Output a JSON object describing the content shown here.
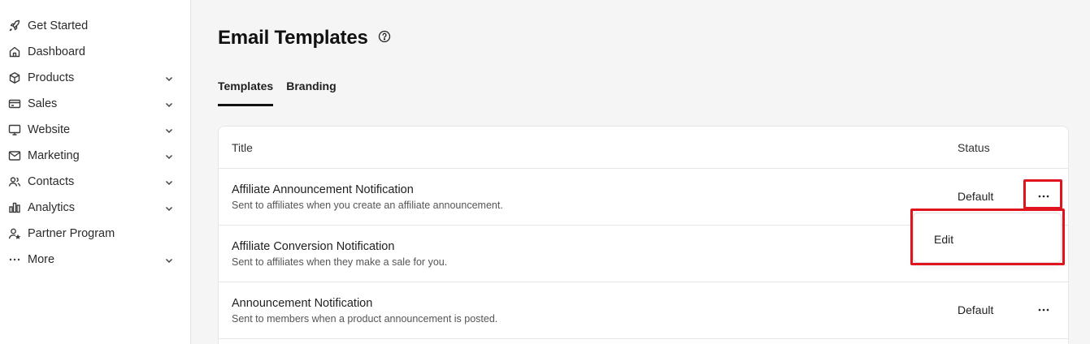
{
  "sidebar": {
    "items": [
      {
        "label": "Get Started",
        "icon": "rocket-icon",
        "has_chevron": false
      },
      {
        "label": "Dashboard",
        "icon": "home-icon",
        "has_chevron": false
      },
      {
        "label": "Products",
        "icon": "box-icon",
        "has_chevron": true
      },
      {
        "label": "Sales",
        "icon": "credit-card-icon",
        "has_chevron": true
      },
      {
        "label": "Website",
        "icon": "monitor-icon",
        "has_chevron": true
      },
      {
        "label": "Marketing",
        "icon": "mail-icon",
        "has_chevron": true
      },
      {
        "label": "Contacts",
        "icon": "users-icon",
        "has_chevron": true
      },
      {
        "label": "Analytics",
        "icon": "bar-chart-icon",
        "has_chevron": true
      },
      {
        "label": "Partner Program",
        "icon": "partner-icon",
        "has_chevron": false
      },
      {
        "label": "More",
        "icon": "more-horizontal-icon",
        "has_chevron": true
      }
    ]
  },
  "header": {
    "title": "Email Templates",
    "help_icon": "help-circle-icon"
  },
  "tabs": [
    {
      "label": "Templates",
      "active": true
    },
    {
      "label": "Branding",
      "active": false
    }
  ],
  "table": {
    "columns": {
      "title": "Title",
      "status": "Status"
    },
    "rows": [
      {
        "name": "Affiliate Announcement Notification",
        "description": "Sent to affiliates when you create an affiliate announcement.",
        "status": "Default"
      },
      {
        "name": "Affiliate Conversion Notification",
        "description": "Sent to affiliates when they make a sale for you.",
        "status": ""
      },
      {
        "name": "Announcement Notification",
        "description": "Sent to members when a product announcement is posted.",
        "status": "Default"
      }
    ]
  },
  "dropdown": {
    "edit_label": "Edit"
  },
  "colors": {
    "highlight": "#e0141e",
    "sidebar_bg": "#ffffff",
    "main_bg": "#f5f5f5"
  }
}
